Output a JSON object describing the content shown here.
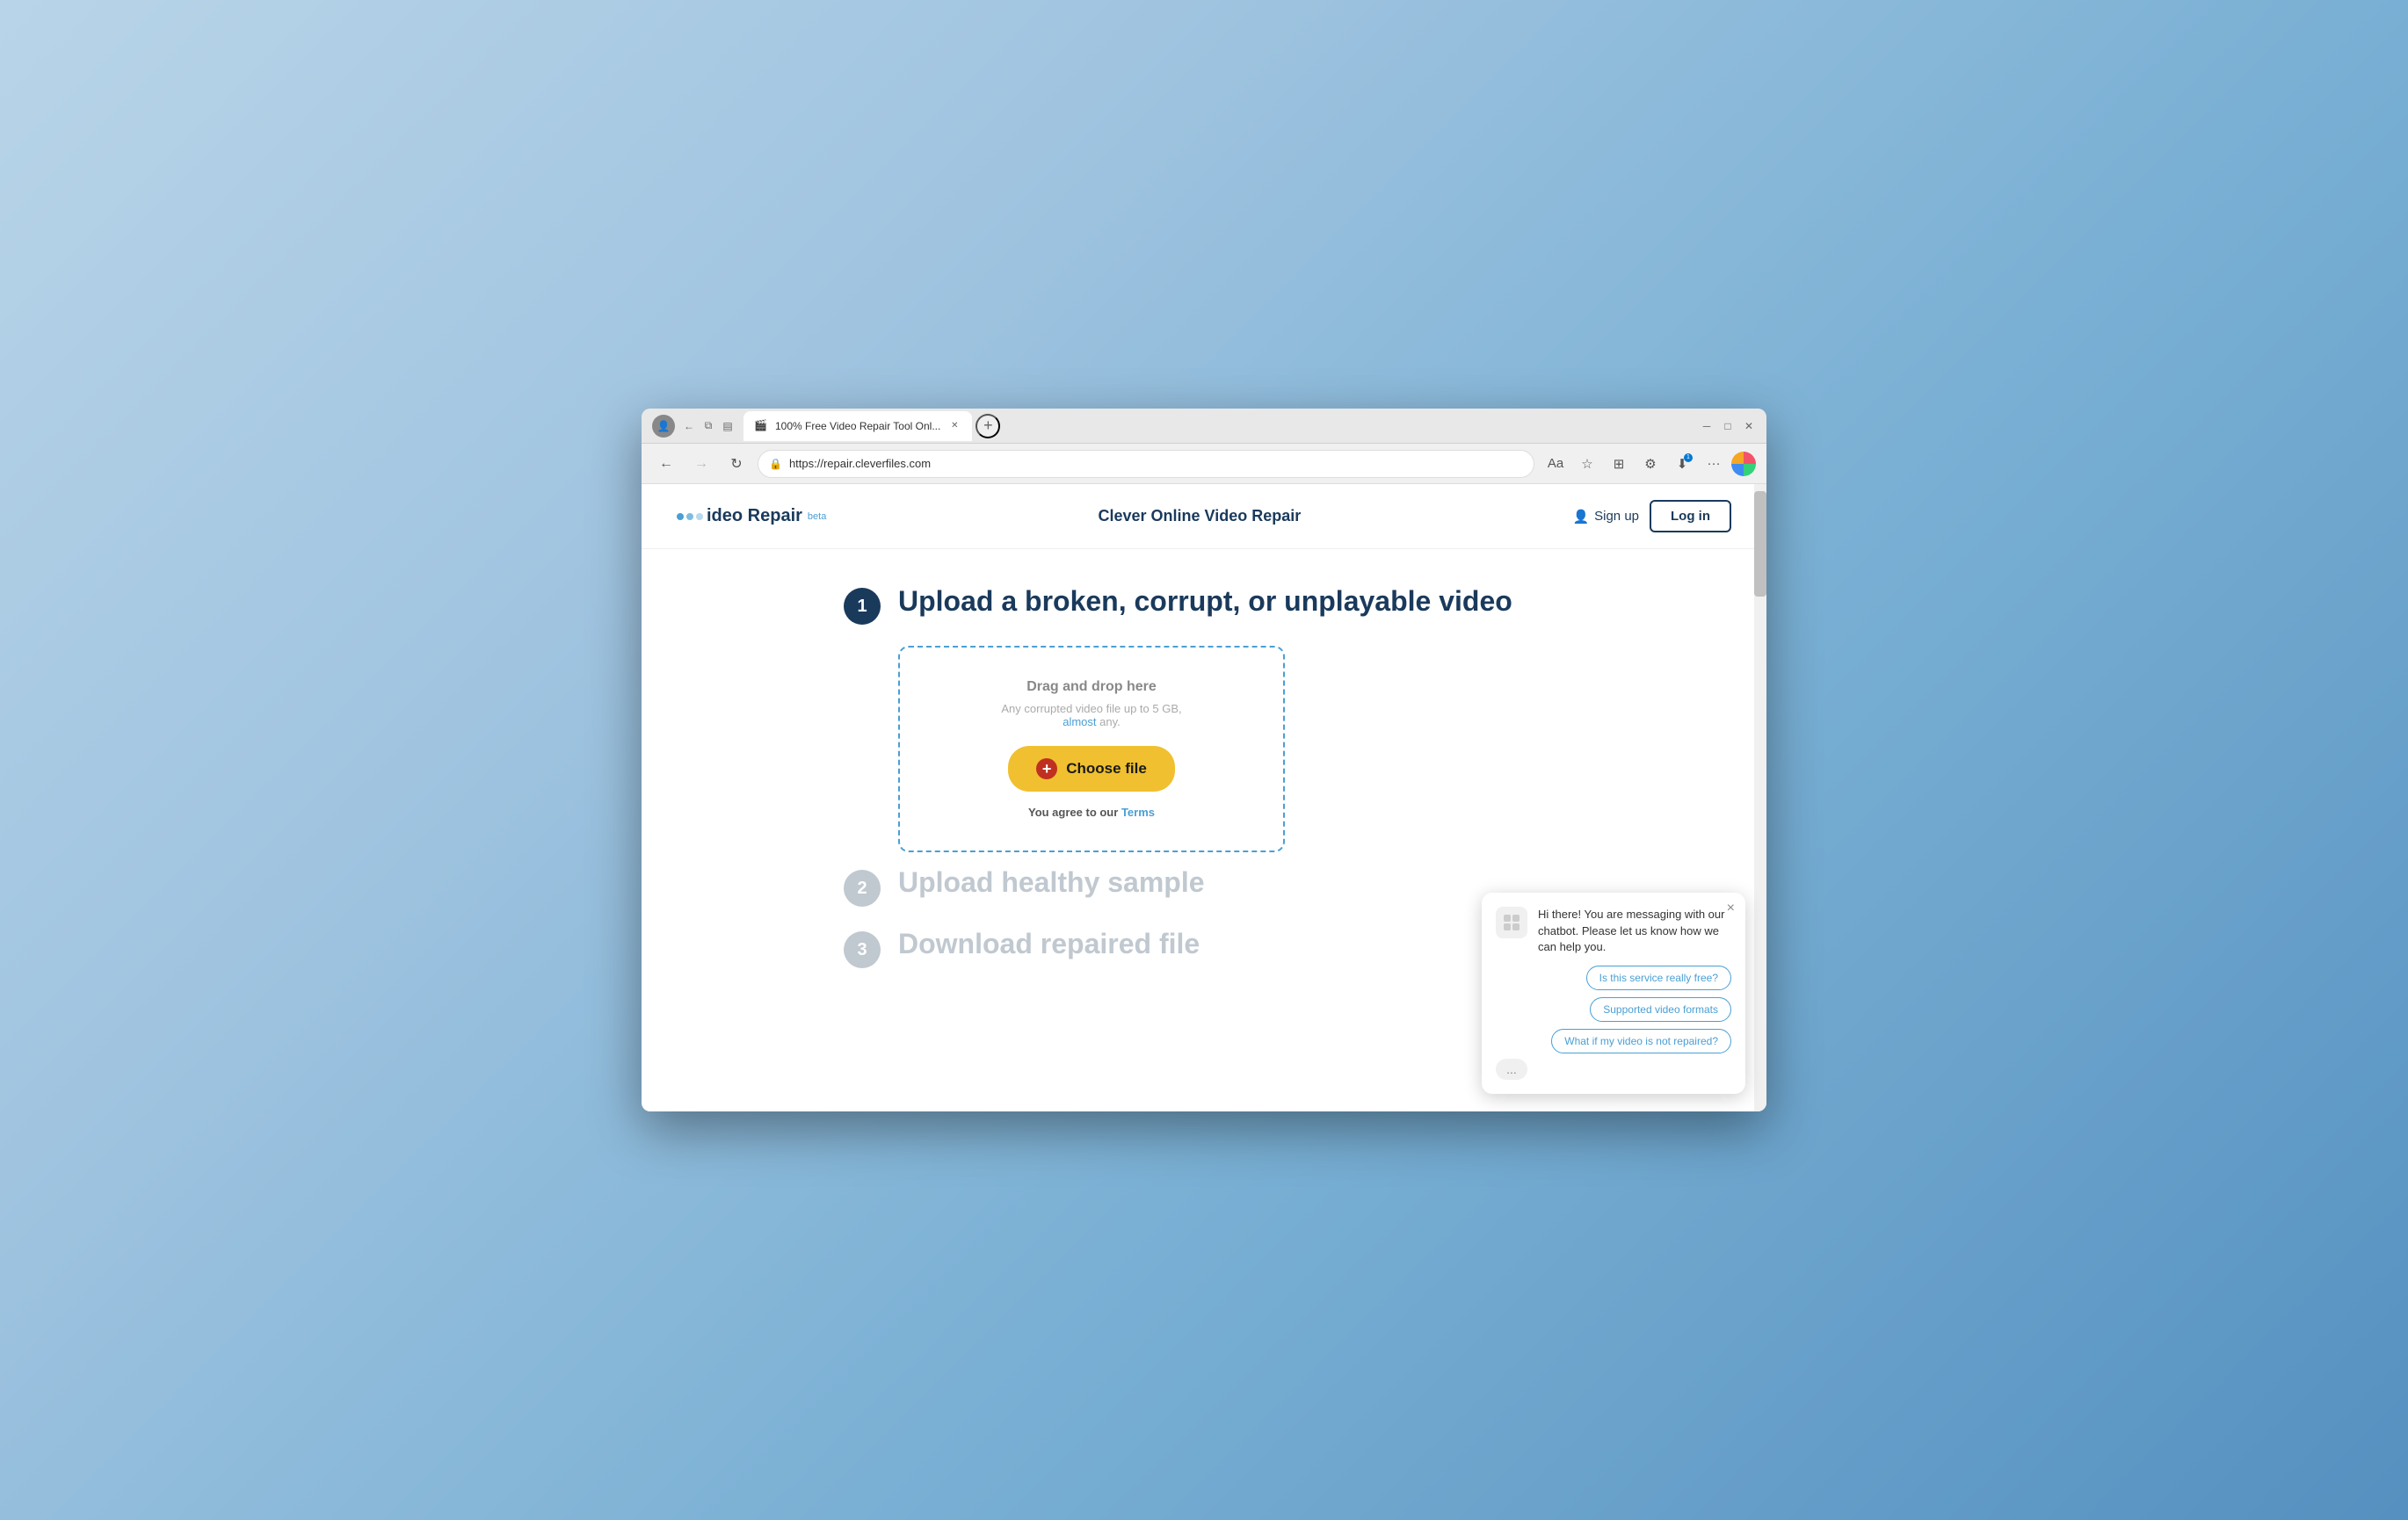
{
  "browser": {
    "tab_title": "100% Free Video Repair Tool Onl...",
    "tab_favicon": "🎬",
    "url": "https://repair.cleverfiles.com",
    "new_tab_label": "+",
    "back_tooltip": "Back",
    "forward_tooltip": "Forward",
    "refresh_tooltip": "Refresh",
    "nav_actions": [
      "read-aloud",
      "favorites",
      "extensions",
      "downloads",
      "more",
      "profile"
    ]
  },
  "site": {
    "logo_text": "ideo Repair",
    "logo_beta": "beta",
    "title": "Clever Online Video Repair",
    "signup_label": "Sign up",
    "login_label": "Log in"
  },
  "steps": [
    {
      "number": "1",
      "active": true,
      "title": "Upload a broken, corrupt, or unplayable video"
    },
    {
      "number": "2",
      "active": false,
      "title": "Upload healthy sample"
    },
    {
      "number": "3",
      "active": false,
      "title": "Download repaired file"
    }
  ],
  "upload_zone": {
    "drag_drop_text": "Drag and drop here",
    "file_info": "Any corrupted video file up to 5 GB,",
    "file_info_link": "almost",
    "file_info_suffix": "any.",
    "choose_file_label": "Choose file",
    "terms_text": "You agree to our",
    "terms_link": "Terms"
  },
  "chatbot": {
    "close_label": "×",
    "message": "Hi there! You are messaging with our chatbot. Please let us know how we can help you.",
    "suggestions": [
      "Is this service really free?",
      "Supported video formats",
      "What if my video is not repaired?"
    ],
    "more_label": "..."
  }
}
